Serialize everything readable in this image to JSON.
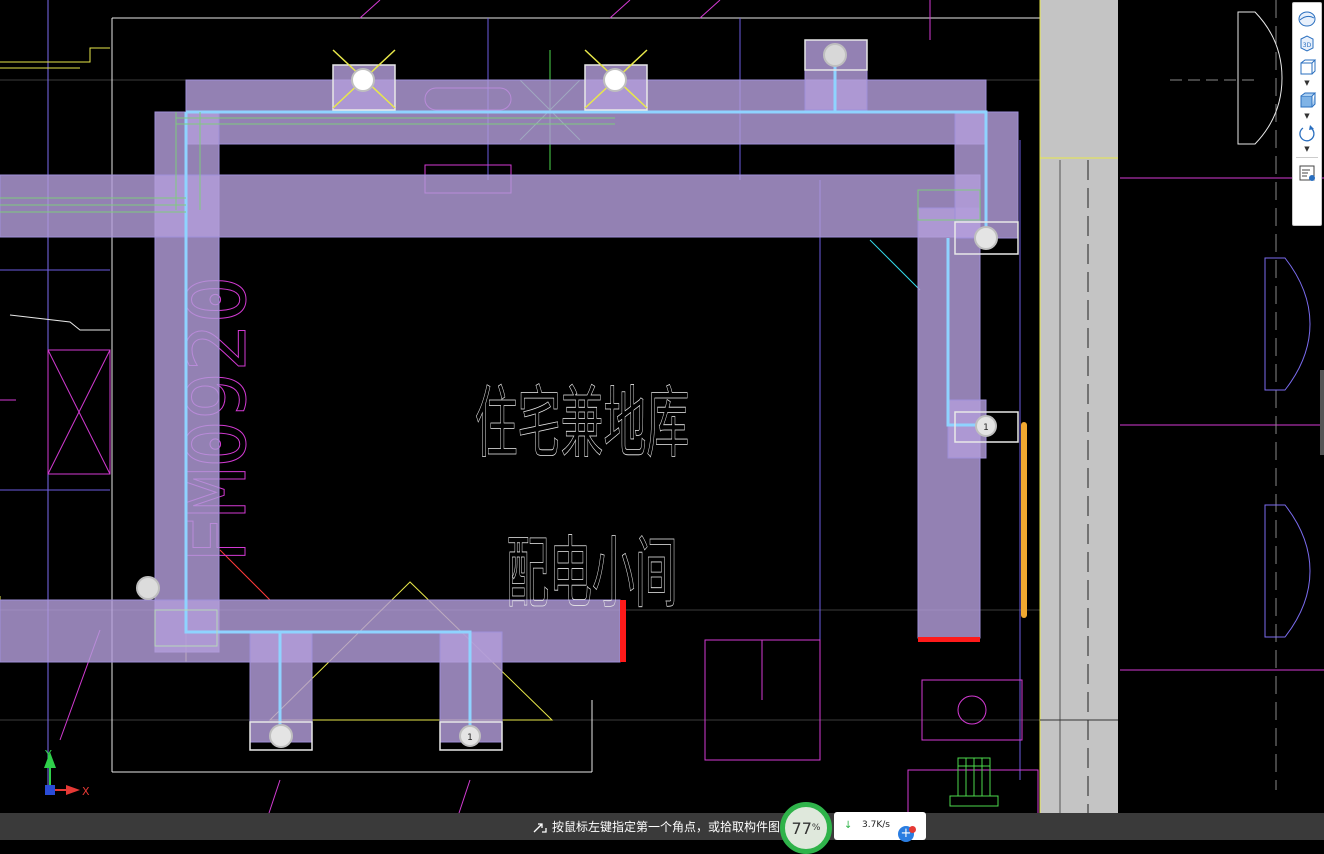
{
  "drawing": {
    "room_label_line1": "住宅兼地库",
    "room_label_line2": "配电小间",
    "vertical_tag": "FM0920"
  },
  "axes": {
    "x_label": "X",
    "y_label": "Y"
  },
  "ribbon": {
    "items": [
      {
        "icon": "sphere-icon"
      },
      {
        "icon": "3d-view-icon",
        "label": "3D"
      },
      {
        "icon": "box-view-icon"
      },
      {
        "icon": "cube-select-icon"
      },
      {
        "icon": "rotate-icon"
      },
      {
        "icon": "properties-list-icon"
      }
    ]
  },
  "status": {
    "prompt": "按鼠标左键指定第一个角点，或拾取构件图",
    "cpu_percent": "77",
    "percent_sign": "%",
    "net_speed": "3.7K/s",
    "net_plus": "+"
  },
  "colors": {
    "duct_fill": "#b39ddb",
    "duct_stroke": "#9f8fd8",
    "pipe": "#8fd3ff",
    "line_magenta": "#d33ad3",
    "line_purple": "#7b6cf0",
    "line_white": "#e8e8e8",
    "line_yellow": "#e8e84a",
    "line_green": "#4cd94c",
    "cyan": "#34d8e8",
    "red": "#ff1a1a",
    "orange": "#f0a830",
    "grey_band": "#c4c4c4"
  }
}
